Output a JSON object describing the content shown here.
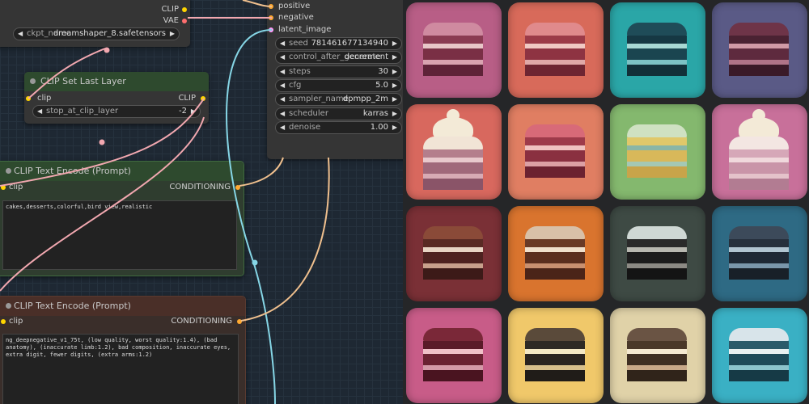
{
  "loader_node": {
    "outputs": [
      "CLIP",
      "VAE"
    ],
    "widget": {
      "name": "ckpt_name",
      "value": "dreamshaper_8.safetensors"
    }
  },
  "clip_set_node": {
    "title": "CLIP Set Last Layer",
    "input": "clip",
    "output": "CLIP",
    "widget": {
      "name": "stop_at_clip_layer",
      "value": "-2"
    }
  },
  "positive_node": {
    "title": "CLIP Text Encode (Prompt)",
    "input": "clip",
    "output": "CONDITIONING",
    "text": "cakes,desserts,colorful,bird view,realistic"
  },
  "negative_node": {
    "title": "CLIP Text Encode (Prompt)",
    "input": "clip",
    "output": "CONDITIONING",
    "text": "ng_deepnegative_v1_75t, (low quality, worst quality:1.4), (bad anatomy), (inaccurate limb:1.2), bad composition, inaccurate eyes, extra digit, fewer digits, (extra arms:1.2)"
  },
  "ksampler_node": {
    "inputs": [
      "positive",
      "negative",
      "latent_image"
    ],
    "widgets": [
      {
        "name": "seed",
        "value": "781461677134940"
      },
      {
        "name": "control_after_generate",
        "value": "decrement"
      },
      {
        "name": "steps",
        "value": "30"
      },
      {
        "name": "cfg",
        "value": "5.0"
      },
      {
        "name": "sampler_name",
        "value": "dpmpp_2m"
      },
      {
        "name": "scheduler",
        "value": "karras"
      },
      {
        "name": "denoise",
        "value": "1.00"
      }
    ]
  },
  "colors": {
    "canvas_bg": "#1e2833",
    "node_bg": "#353535",
    "green_title": "#2e4a2e",
    "clip_port": "#ffd500",
    "conditioning_port": "#ffa931",
    "latent_port": "#ff9cf9",
    "clip_wire": "#f2a8b0",
    "latent_wire": "#86d6e6",
    "cond_wire": "#f0c08e"
  },
  "gallery": {
    "tiles": [
      {
        "bg": "#b85e86",
        "top": "#cf8aa0",
        "layers": [
          "#8a3b52",
          "#e8c6c8",
          "#7a2f45",
          "#d9a3b0",
          "#5f2338"
        ]
      },
      {
        "bg": "#d86a5a",
        "top": "#e08a8c",
        "layers": [
          "#9c3b48",
          "#f0c9c4",
          "#8e3342",
          "#e0a8a8",
          "#6e2532"
        ]
      },
      {
        "bg": "#2aa6a7",
        "top": "#1f4c58",
        "layers": [
          "#163843",
          "#a8d8d4",
          "#1a4550",
          "#7cc2c4",
          "#123038"
        ]
      },
      {
        "bg": "#5a5a86",
        "top": "#6e3448",
        "layers": [
          "#4a2232",
          "#d09aa6",
          "#5e2a3e",
          "#b07488",
          "#3a1a28"
        ]
      },
      {
        "bg": "#d8685e",
        "top": "#f1e4d6",
        "layers": [
          "#b47e8c",
          "#e8c8cc",
          "#a0687a",
          "#d7aab4",
          "#8a5468"
        ],
        "cream": true
      },
      {
        "bg": "#e07e62",
        "top": "#d86a78",
        "layers": [
          "#9e3a4a",
          "#f0c2c0",
          "#8a3040",
          "#dca0a4",
          "#6c2230"
        ]
      },
      {
        "bg": "#84b86e",
        "top": "#cfe1c2",
        "layers": [
          "#e0c86a",
          "#8ab6a6",
          "#d8b85a",
          "#a4c8b4",
          "#c8a44a"
        ]
      },
      {
        "bg": "#c8709a",
        "top": "#f3e6e2",
        "layers": [
          "#d6a7b8",
          "#f0d8dc",
          "#c994a8",
          "#e4c2ca",
          "#b27c92"
        ],
        "cream": true
      },
      {
        "bg": "#7a3036",
        "top": "#8a4a38",
        "layers": [
          "#5a2a24",
          "#e8d4c4",
          "#4e2220",
          "#c8a08c",
          "#3c1a18"
        ]
      },
      {
        "bg": "#d9742e",
        "top": "#d8c0a8",
        "layers": [
          "#6a3a26",
          "#f0e0cc",
          "#5a2e1e",
          "#c89070",
          "#4a2418"
        ]
      },
      {
        "bg": "#3e4a44",
        "top": "#cfd8d4",
        "layers": [
          "#2a2a2a",
          "#b8b8b0",
          "#1c1c1c",
          "#8c8a84",
          "#141414"
        ]
      },
      {
        "bg": "#2e6a84",
        "top": "#3c4a5a",
        "layers": [
          "#26303c",
          "#b0c4d0",
          "#1e2834",
          "#7a96aa",
          "#182028"
        ]
      },
      {
        "bg": "#c85c88",
        "top": "#7a2838",
        "layers": [
          "#5a1a28",
          "#f0c0c8",
          "#6a2232",
          "#d49aa8",
          "#4a1420"
        ]
      },
      {
        "bg": "#f0c86a",
        "top": "#5a4a3a",
        "layers": [
          "#2e2a24",
          "#f4e8c4",
          "#2a2420",
          "#d8c08c",
          "#201c18"
        ]
      },
      {
        "bg": "#e0d2a8",
        "top": "#6a5444",
        "layers": [
          "#4a3828",
          "#f4e8d0",
          "#3e2e22",
          "#c8a888",
          "#30241a"
        ]
      },
      {
        "bg": "#3ab0c4",
        "top": "#d8e4ea",
        "layers": [
          "#2a5a6a",
          "#e8f0f0",
          "#1e4a58",
          "#8cc4cc",
          "#163a46"
        ]
      }
    ]
  }
}
